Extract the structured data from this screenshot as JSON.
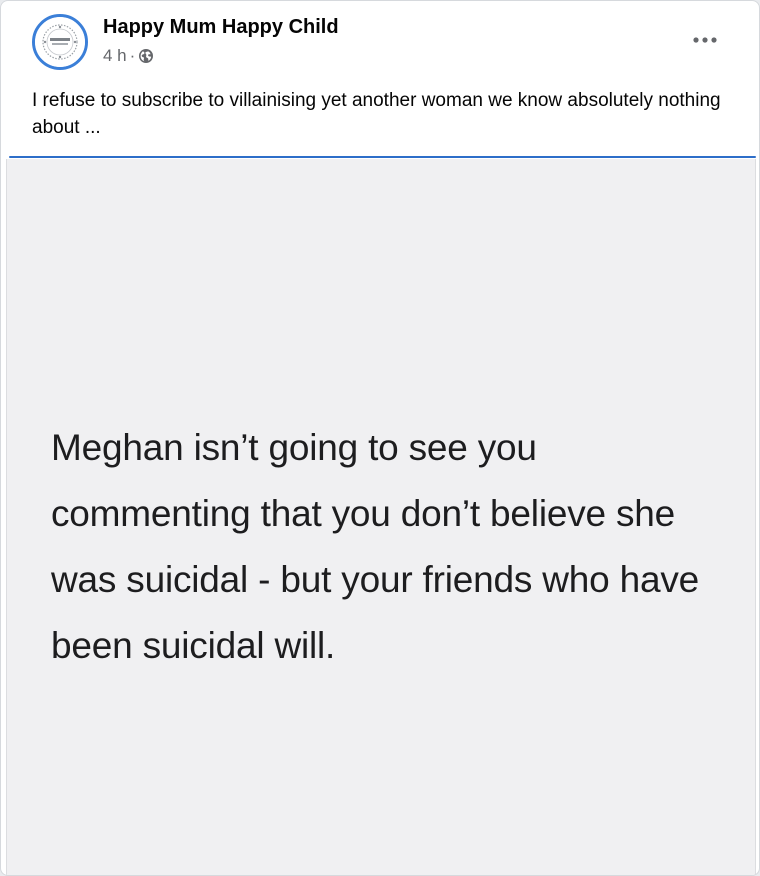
{
  "post": {
    "author": "Happy Mum Happy Child",
    "time": "4 h",
    "separator": "·",
    "visibility_icon": "globe-icon",
    "more_icon": "more-horizontal-icon",
    "caption": "I refuse to subscribe to villainising yet another woman we know absolutely nothing about ...",
    "image_text": "Meghan isn’t going to see you commenting that you don’t believe she was suicidal - but your friends who have been suicidal will.",
    "avatar_logo_text": "HAPPY MUM"
  },
  "colors": {
    "accent": "#2d6ec9",
    "avatar_ring": "#3b7fd8",
    "secondary_text": "#65676b",
    "image_background": "#f0f0f2"
  }
}
